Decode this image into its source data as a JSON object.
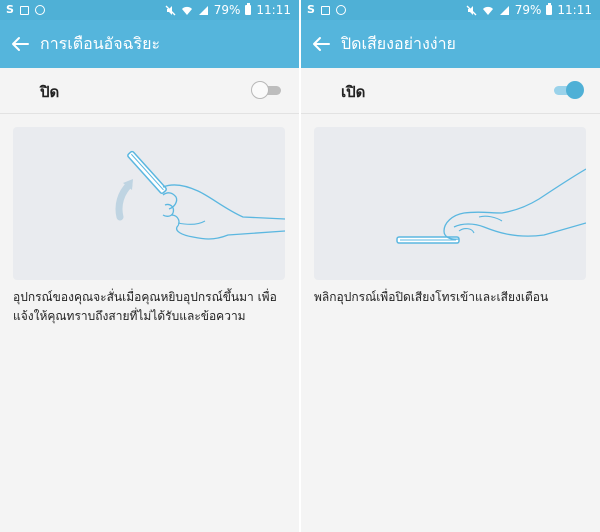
{
  "status_bar": {
    "left_icons": [
      "s-app-icon",
      "gallery-icon",
      "smiley-icon"
    ],
    "right_icons": [
      "mute-icon",
      "wifi-icon",
      "signal-icon"
    ],
    "battery": "79%",
    "time": "11:11"
  },
  "screens": [
    {
      "title": "การเตือนอัจฉริยะ",
      "toggle_label": "ปิด",
      "toggle_on": false,
      "description_lines": [
        "อุปกรณ์ของคุณจะสั่นเมื่อคุณหยิบอุปกรณ์ขึ้นมา เพื่อ",
        "แจ้งให้คุณทราบถึงสายที่ไม่ได้รับและข้อความ"
      ]
    },
    {
      "title": "ปิดเสียงอย่างง่าย",
      "toggle_label": "เปิด",
      "toggle_on": true,
      "description_lines": [
        "พลิกอุปกรณ์เพื่อปิดเสียงโทรเข้าและเสียงเตือน"
      ]
    }
  ],
  "colors": {
    "status_bar": "#4fb0d6",
    "app_bar": "#55b5dc",
    "accent": "#4fb0d6",
    "background": "#f4f4f4",
    "illustration_bg": "#e9ebef",
    "illustration_line": "#5bb7e0"
  }
}
